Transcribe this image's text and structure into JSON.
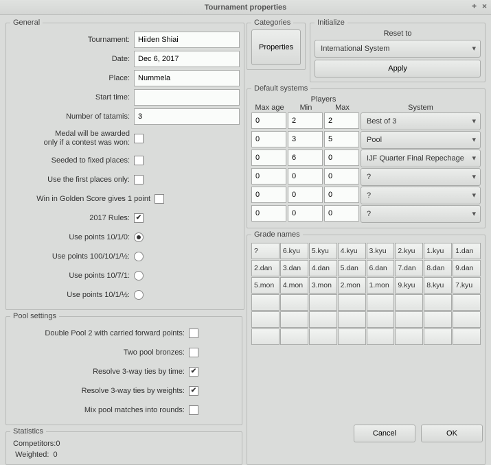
{
  "window": {
    "title": "Tournament properties"
  },
  "general": {
    "legend": "General",
    "tournament_label": "Tournament:",
    "tournament_value": "Hiiden Shiai",
    "date_label": "Date:",
    "date_value": "Dec 6, 2017",
    "place_label": "Place:",
    "place_value": "Nummela",
    "start_label": "Start time:",
    "start_value": "",
    "tatamis_label": "Number of tatamis:",
    "tatamis_value": "3",
    "medal_label1": "Medal will be awarded",
    "medal_label2": "only if a contest was won:",
    "seeded_label": "Seeded to fixed places:",
    "first_places_label": "Use the first places only:",
    "golden_label": "Win in Golden Score gives 1 point",
    "rules_label": "2017 Rules:",
    "points_1010_label": "Use points 10/1/0:",
    "points_1001012_label": "Use points 100/10/1/½:",
    "points_1071_label": "Use points 10/7/1:",
    "points_1012_label": "Use points 10/1/½:"
  },
  "pool": {
    "legend": "Pool settings",
    "doublepool_label": "Double Pool 2 with carried forward points:",
    "twobronze_label": "Two pool bronzes:",
    "resolve_time_label": "Resolve 3-way ties by time:",
    "resolve_weight_label": "Resolve 3-way ties by weights:",
    "mixpool_label": "Mix pool matches into rounds:"
  },
  "stats": {
    "legend": "Statistics",
    "competitors_label": "Competitors:",
    "competitors_value": "0",
    "weighted_label": "Weighted:",
    "weighted_value": "0"
  },
  "categories": {
    "legend": "Categories",
    "properties_btn": "Properties"
  },
  "initialize": {
    "legend": "Initialize",
    "reset_label": "Reset to",
    "system_sel": "International System",
    "apply_btn": "Apply"
  },
  "defaults": {
    "legend": "Default systems",
    "players_header": "Players",
    "maxage_header": "Max age",
    "min_header": "Min",
    "max_header": "Max",
    "system_header": "System",
    "rows": [
      {
        "age": "0",
        "min": "2",
        "max": "2",
        "sys": "Best of 3"
      },
      {
        "age": "0",
        "min": "3",
        "max": "5",
        "sys": "Pool"
      },
      {
        "age": "0",
        "min": "6",
        "max": "0",
        "sys": "IJF Quarter Final Repechage"
      },
      {
        "age": "0",
        "min": "0",
        "max": "0",
        "sys": "?"
      },
      {
        "age": "0",
        "min": "0",
        "max": "0",
        "sys": "?"
      },
      {
        "age": "0",
        "min": "0",
        "max": "0",
        "sys": "?"
      }
    ]
  },
  "grades": {
    "legend": "Grade names",
    "rows": [
      [
        "?",
        "6.kyu",
        "5.kyu",
        "4.kyu",
        "3.kyu",
        "2.kyu",
        "1.kyu",
        "1.dan"
      ],
      [
        "2.dan",
        "3.dan",
        "4.dan",
        "5.dan",
        "6.dan",
        "7.dan",
        "8.dan",
        "9.dan"
      ],
      [
        "5.mon",
        "4.mon",
        "3.mon",
        "2.mon",
        "1.mon",
        "9.kyu",
        "8.kyu",
        "7.kyu"
      ],
      [
        "",
        "",
        "",
        "",
        "",
        "",
        "",
        ""
      ],
      [
        "",
        "",
        "",
        "",
        "",
        "",
        "",
        ""
      ],
      [
        "",
        "",
        "",
        "",
        "",
        "",
        "",
        ""
      ]
    ]
  },
  "footer": {
    "cancel": "Cancel",
    "ok": "OK"
  }
}
